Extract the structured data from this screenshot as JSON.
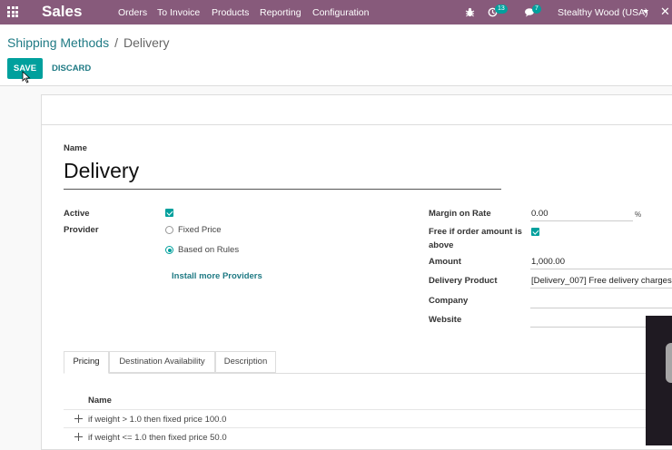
{
  "topbar": {
    "app_name": "Sales",
    "menu": [
      "Orders",
      "To Invoice",
      "Products",
      "Reporting",
      "Configuration"
    ],
    "activity_count": "13",
    "messages_count": "7",
    "company": "Stealthy Wood (USA)",
    "colors": {
      "bar": "#875a7b",
      "badge": "#00a09d"
    }
  },
  "control_panel": {
    "breadcrumb": {
      "parent": "Shipping Methods",
      "separator": "/",
      "current": "Delivery"
    },
    "save_label": "SAVE",
    "discard_label": "DISCARD"
  },
  "form": {
    "name_label": "Name",
    "name_value": "Delivery",
    "left": {
      "active_label": "Active",
      "active_checked": true,
      "provider_label": "Provider",
      "provider_options": [
        "Fixed Price",
        "Based on Rules"
      ],
      "provider_selected": "Based on Rules",
      "install_link": "Install more Providers"
    },
    "right": {
      "margin_label": "Margin on Rate",
      "margin_value": "0.00",
      "margin_unit": "%",
      "free_label_line1": "Free if order amount is",
      "free_label_line2": "above",
      "free_checked": true,
      "amount_label": "Amount",
      "amount_value": "1,000.00",
      "product_label": "Delivery Product",
      "product_value": "[Delivery_007] Free delivery charges",
      "company_label": "Company",
      "company_value": "",
      "website_label": "Website",
      "website_value": ""
    },
    "tabs": [
      "Pricing",
      "Destination Availability",
      "Description"
    ],
    "active_tab": "Pricing",
    "pricing": {
      "column": "Name",
      "rows": [
        "if weight > 1.0 then fixed price 100.0",
        "if weight <= 1.0 then fixed price 50.0"
      ]
    }
  },
  "icons": [
    "apps-icon",
    "bug-icon",
    "activity-icon",
    "chat-icon",
    "chevron-down-icon",
    "close-icon",
    "drag-handle-icon",
    "cursor-icon"
  ]
}
